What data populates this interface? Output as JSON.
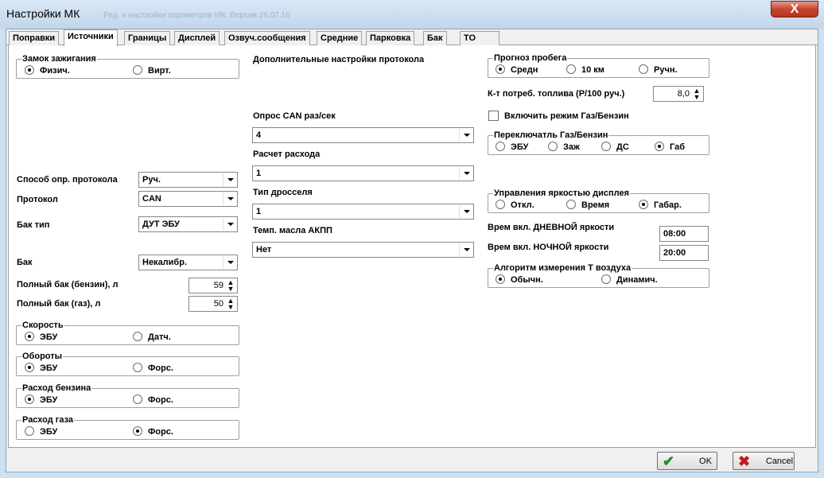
{
  "window": {
    "title": "Настройки МК",
    "ghost_title": "Ред. и настройки параметров МК. Версия 26.07.16",
    "close_glyph": "X"
  },
  "tabs": [
    "Поправки",
    "Источники",
    "Границы",
    "Дисплей",
    "Озвуч.сообщения",
    "Средние",
    "Парковка",
    "Бак",
    "ТО"
  ],
  "active_tab": "Источники",
  "left": {
    "ignition_group": {
      "title": "Замок зажигания",
      "opt1": "Физич.",
      "opt2": "Вирт.",
      "selected": "Физич."
    },
    "protocol_method": {
      "label": "Способ опр. протокола",
      "value": "Руч."
    },
    "protocol": {
      "label": "Протокол",
      "value": "CAN"
    },
    "tank_type": {
      "label": "Бак тип",
      "value": "ДУТ ЭБУ"
    },
    "tank": {
      "label": "Бак",
      "value": "Некалибр."
    },
    "full_tank_petrol": {
      "label": "Полный бак (бензин), л",
      "value": "59"
    },
    "full_tank_gas": {
      "label": "Полный бак (газ), л",
      "value": "50"
    },
    "speed_group": {
      "title": "Скорость",
      "opt1": "ЭБУ",
      "opt2": "Датч.",
      "selected": "ЭБУ"
    },
    "rpm_group": {
      "title": "Обороты",
      "opt1": "ЭБУ",
      "opt2": "Форс.",
      "selected": "ЭБУ"
    },
    "petrol_group": {
      "title": "Расход бензина",
      "opt1": "ЭБУ",
      "opt2": "Форс.",
      "selected": "ЭБУ"
    },
    "gas_group": {
      "title": "Расход газа",
      "opt1": "ЭБУ",
      "opt2": "Форс.",
      "selected": "Форс."
    }
  },
  "middle": {
    "extra_header": "Дополнительные настройки протокола",
    "can_poll": {
      "label": "Опрос CAN раз/сек",
      "value": "4"
    },
    "consumption_calc": {
      "label": "Расчет расхода",
      "value": "1"
    },
    "throttle_type": {
      "label": "Тип дросселя",
      "value": "1"
    },
    "atf_temp": {
      "label": "Темп. масла АКПП",
      "value": "Нет"
    }
  },
  "right": {
    "mileage_group": {
      "title": "Прогноз пробега",
      "opt1": "Средн",
      "opt2": "10 км",
      "opt3": "Ручн.",
      "selected": "Средн"
    },
    "fuel_coef": {
      "label": "К-т потреб. топлива (Р/100 руч.)",
      "value": "8,0"
    },
    "gas_petrol_mode": {
      "label": "Включить режим Газ/Бензин",
      "checked": false
    },
    "switch_group": {
      "title": "Переключатль Газ/Бензин",
      "opt1": "ЭБУ",
      "opt2": "Заж",
      "opt3": "ДС",
      "opt4": "Габ",
      "selected": "Габ"
    },
    "brightness_group": {
      "title": "Управления яркостью дисплея",
      "opt1": "Откл.",
      "opt2": "Время",
      "opt3": "Габар.",
      "selected": "Габар."
    },
    "day_time": {
      "label": "Врем вкл. ДНЕВНОЙ яркости",
      "value": "08:00"
    },
    "night_time": {
      "label": "Врем вкл. НОЧНОЙ яркости",
      "value": "20:00"
    },
    "temp_algo_group": {
      "title": "Алгоритм измерения Т воздуха",
      "opt1": "Обычн.",
      "opt2": "Динамич.",
      "selected": "Обычн."
    }
  },
  "footer": {
    "ok_label": "OK",
    "cancel_label": "Cancel",
    "ok_icon": "checkmark-icon",
    "cancel_icon": "cross-icon"
  },
  "colors": {
    "title_bar": "#cfe0f1",
    "close_button": "#c7452f",
    "ok_icon": "#1f8a1f",
    "cancel_icon": "#c41a1a"
  }
}
